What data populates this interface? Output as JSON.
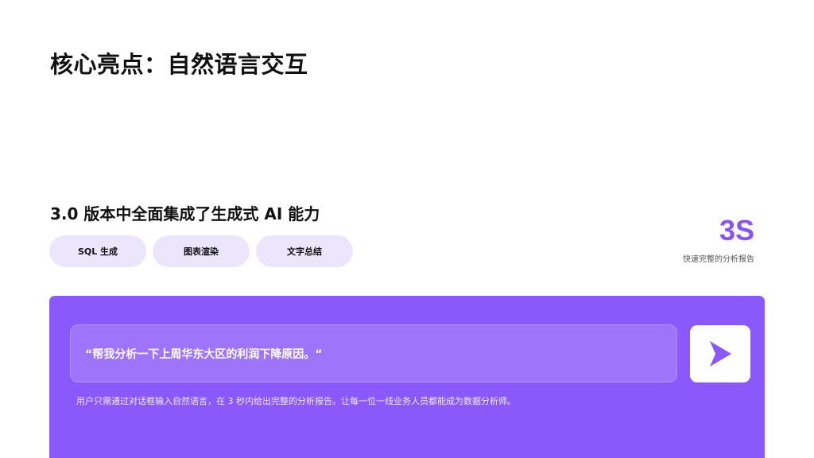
{
  "slide": {
    "title": "核心亮点：自然语言交互",
    "subtitle": "3.0 版本中全面集成了生成式 AI 能力",
    "features": [
      {
        "label": "SQL 生成"
      },
      {
        "label": "图表渲染"
      },
      {
        "label": "文字总结"
      }
    ],
    "stat": {
      "value": "3S",
      "caption": "快速完整的分析报告"
    },
    "demo": {
      "query": "“帮我分析一下上周华东大区的利润下降原因。“",
      "send_icon": "play-arrow-icon",
      "description": "用户只需通过对话框输入自然语言，在 3 秒内给出完整的分析报告。让每一位一线业务人员都能成为数据分析师。"
    },
    "colors": {
      "accent": "#8b58fb",
      "pill_background": "#ece6fd",
      "stat_color": "#8b55f6"
    }
  }
}
